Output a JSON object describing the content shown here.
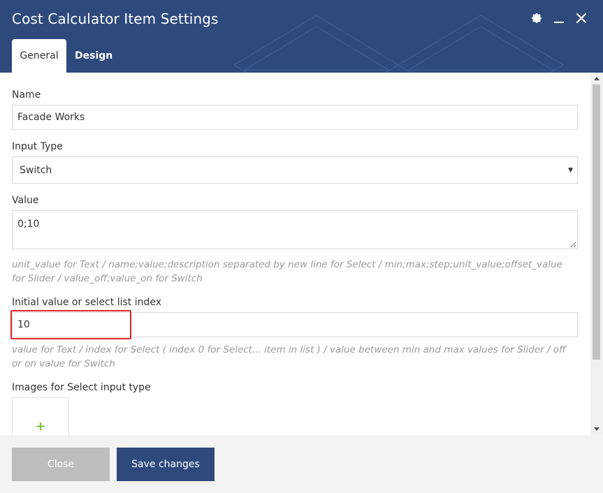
{
  "window": {
    "title": "Cost Calculator Item Settings",
    "icons": {
      "settings": "gear-icon",
      "minimize": "minimize-icon",
      "close": "close-icon"
    }
  },
  "tabs": [
    {
      "label": "General",
      "active": true
    },
    {
      "label": "Design",
      "active": false
    }
  ],
  "form": {
    "name_label": "Name",
    "name_value": "Facade Works",
    "input_type_label": "Input Type",
    "input_type_value": "Switch",
    "value_label": "Value",
    "value_value": "0;10",
    "value_help": "unit_value for Text / name;value;description separated by new line for Select / min;max;step;unit_value;offset_value for Slider / value_off;value_on for Switch",
    "initial_label": "Initial value or select list index",
    "initial_value": "10",
    "initial_help": "value for Text / index for Select ( index 0 for Select... item in list ) / value between min and max values for Slider / off or on value for Switch",
    "images_label": "Images for Select input type",
    "add_image_glyph": "+"
  },
  "footer": {
    "close_label": "Close",
    "save_label": "Save changes"
  },
  "colors": {
    "header": "#2e4a7d",
    "save_button": "#2e4a7d",
    "close_button": "#bdbdbd",
    "highlight": "#d9262b",
    "add_icon": "#7ac143"
  }
}
